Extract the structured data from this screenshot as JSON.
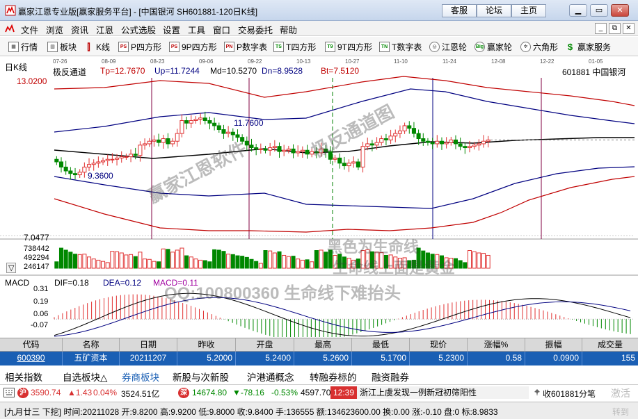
{
  "titlebar": {
    "title": "赢家江恩专业版[赢家服务平台] - [中国银河  SH601881-120日K线]",
    "links": [
      "客服",
      "论坛",
      "主页"
    ],
    "min_label": "▭",
    "max_label": "□",
    "close_label": "✕"
  },
  "menubar": {
    "items": [
      "文件",
      "浏览",
      "资讯",
      "江恩",
      "公式选股",
      "设置",
      "工具",
      "窗口",
      "交易委托",
      "帮助"
    ],
    "mdi": [
      "_",
      "⧉",
      "✕"
    ]
  },
  "toolbar": {
    "items": [
      {
        "label": "行情",
        "icon": "grid-icon"
      },
      {
        "label": "板块",
        "icon": "sector-icon"
      },
      {
        "label": "K线",
        "icon": "kline-icon"
      },
      {
        "label": "P四方形",
        "icon": "PS"
      },
      {
        "label": "9P四方形",
        "icon": "PS"
      },
      {
        "label": "P数字表",
        "icon": "PN"
      },
      {
        "label": "T四方形",
        "icon": "TS"
      },
      {
        "label": "9T四方形",
        "icon": "T9"
      },
      {
        "label": "T数字表",
        "icon": "TN"
      },
      {
        "label": "江恩轮",
        "icon": "wheel-icon"
      },
      {
        "label": "赢家轮",
        "icon": "Big"
      },
      {
        "label": "六角形",
        "icon": "hex-icon"
      },
      {
        "label": "赢家服务",
        "icon": "dollar-icon"
      }
    ]
  },
  "chart": {
    "period_label": "日K线",
    "indicator_name": "极反通道",
    "stats": [
      "Tp=12.7670",
      "Up=11.7244",
      "Md=10.5270",
      "Dn=8.9528",
      "Bt=7.5120"
    ],
    "stock_label": "601881  中国银河",
    "date_ticks": [
      "07-26",
      "08-09",
      "08-23",
      "09-06",
      "09-22",
      "10-13",
      "10-27",
      "11-10",
      "11-24",
      "12-08",
      "12-22",
      "01-05"
    ],
    "price_top": "13.0200",
    "price_bottom": "7.0477",
    "high_label": "11.7600",
    "low_label": "9.3600",
    "volume_ticks": [
      "738442",
      "492294",
      "246147"
    ],
    "macd_name": "MACD",
    "macd_stats": [
      "DIF=0.18",
      "DEA=0.12",
      "MACD=0.11"
    ],
    "macd_ticks": [
      "0.31",
      "0.19",
      "0.06",
      "-0.07"
    ],
    "scroll_down": "▽"
  },
  "watermarks": [
    "赢家江恩软件",
    "极反通道图",
    "黑色为生命线",
    "生命线上面是黄金",
    "QQ:100800360 生命线下难抬头"
  ],
  "grid": {
    "headers": [
      "代码",
      "名称",
      "日期",
      "昨收",
      "开盘",
      "最高",
      "最低",
      "现价",
      "涨幅%",
      "振幅",
      "成交量"
    ],
    "row": [
      "600390",
      "五矿资本",
      "20211207",
      "5.2000",
      "5.2400",
      "5.2600",
      "5.1700",
      "5.2300",
      "0.58",
      "0.0900",
      "155"
    ]
  },
  "tabs": [
    "相关指数",
    "自选板块△",
    "券商板块",
    "新股与次新股",
    "沪港通概念",
    "转融券标的",
    "融资融券"
  ],
  "index_bar": {
    "sh_badge": "沪",
    "sh_value": "3590.74",
    "sh_change": "▲1.43",
    "sh_pct": "0.04%",
    "sh_amount": "3524.51亿",
    "sz_badge": "深",
    "sz_value": "14674.80",
    "sz_change": "▼-78.16",
    "sz_pct": "-0.53%",
    "sz_amount": "4597.70",
    "news_time": "12:39",
    "news_text": "浙江上虞发现一例新冠初筛阳性",
    "right_text": "收601881分笔",
    "extra": "激活"
  },
  "status_bar": {
    "text": "[九月廿三  下挖] 时间:20211028 开:9.8200 高:9.9200 低:9.8000 收:9.8400 手:136555 额:134623600.00 换:0.00 涨:-0.10 盘:0 标:8.9833",
    "extra": "转到"
  },
  "colors": {
    "up": "#e03030",
    "down": "#008800",
    "upper_band": "#c00000",
    "mid_band": "#000080",
    "life_line": "#000000",
    "selected_row": "#1a5fb4",
    "header_bg": "#d9d9d9"
  },
  "chart_data": {
    "type": "candlestick",
    "title": "中国银河 SH601881 日K线",
    "price_range": [
      7.0477,
      13.02
    ],
    "closes": [
      9.9,
      9.7,
      9.55,
      9.45,
      9.4,
      9.5,
      9.7,
      9.8,
      9.85,
      9.9,
      9.95,
      10.0,
      10.0,
      10.05,
      10.1,
      10.1,
      10.2,
      10.15,
      10.55,
      10.6,
      10.7,
      10.75,
      10.65,
      10.8,
      10.6,
      10.7,
      11.0,
      11.5,
      11.4,
      11.5,
      11.55,
      11.6,
      11.5,
      11.4,
      11.3,
      11.15,
      11.0,
      11.05,
      10.95,
      10.85,
      10.7,
      10.55,
      10.45,
      10.4,
      10.4,
      10.35,
      10.45,
      10.5,
      10.3,
      10.35,
      10.4,
      10.25,
      10.3,
      10.35,
      10.2,
      10.3,
      10.25,
      10.4,
      10.3,
      10.0,
      10.05,
      9.85,
      9.75,
      9.85,
      9.9,
      9.7,
      10.5,
      10.6,
      10.55,
      10.65,
      10.8,
      10.75,
      10.9,
      11.0,
      11.1,
      11.3,
      11.2,
      11.0,
      10.8,
      10.7,
      10.65,
      10.6,
      10.7,
      10.6,
      10.65,
      10.75,
      10.6,
      10.5,
      10.45,
      10.5,
      10.55,
      10.6,
      10.7,
      10.75
    ],
    "volume_range": [
      0,
      984589
    ],
    "macd_range": [
      -0.12,
      0.32
    ],
    "dif": 0.18,
    "dea": 0.12,
    "macd": 0.11
  }
}
